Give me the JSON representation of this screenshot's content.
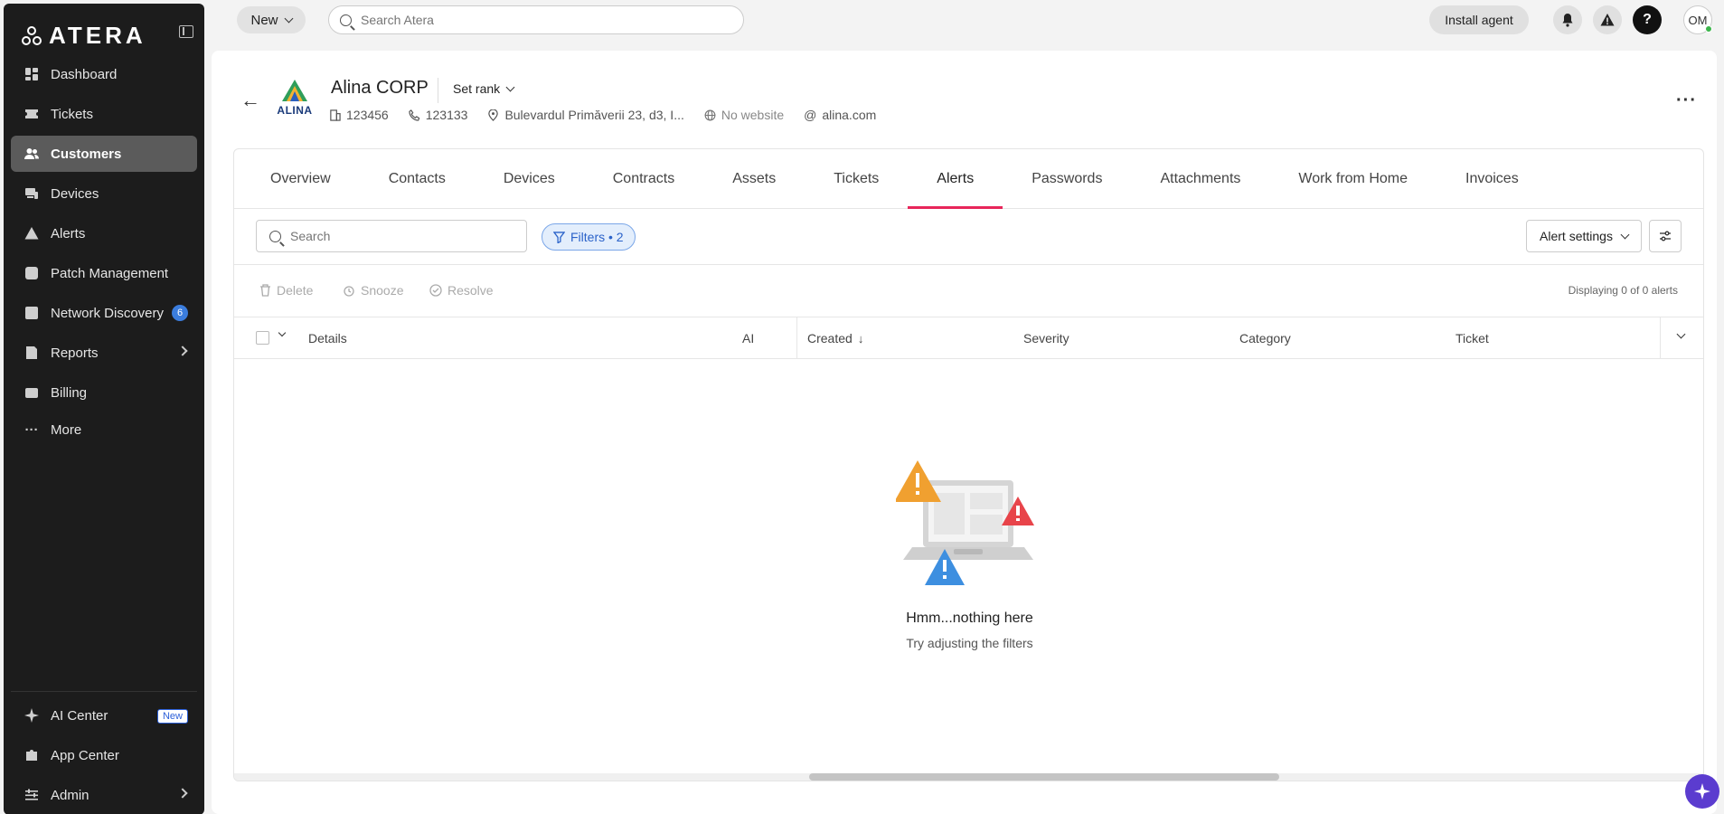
{
  "app": {
    "logo_text": "ATERA"
  },
  "sidebar": {
    "items": [
      {
        "label": "Dashboard"
      },
      {
        "label": "Tickets"
      },
      {
        "label": "Customers",
        "active": true
      },
      {
        "label": "Devices"
      },
      {
        "label": "Alerts"
      },
      {
        "label": "Patch Management"
      },
      {
        "label": "Network Discovery",
        "badge": "6"
      },
      {
        "label": "Reports"
      },
      {
        "label": "Billing"
      }
    ],
    "more_label": "More",
    "bottom": [
      {
        "label": "AI Center",
        "tag": "New"
      },
      {
        "label": "App Center"
      },
      {
        "label": "Admin"
      }
    ]
  },
  "topbar": {
    "new_label": "New",
    "search_placeholder": "Search Atera",
    "install_label": "Install agent",
    "avatar_initials": "OM"
  },
  "customer": {
    "logo_text": "ALINA",
    "name": "Alina CORP",
    "set_rank_label": "Set rank",
    "company_id": "123456",
    "phone": "123133",
    "address": "Bulevardul Primăverii 23, d3, I...",
    "website": "No website",
    "domain": "alina.com"
  },
  "tabs": [
    "Overview",
    "Contacts",
    "Devices",
    "Contracts",
    "Assets",
    "Tickets",
    "Alerts",
    "Passwords",
    "Attachments",
    "Work from Home",
    "Invoices"
  ],
  "active_tab": "Alerts",
  "filters": {
    "search_placeholder": "Search",
    "filters_label": "Filters • 2",
    "alert_settings_label": "Alert settings"
  },
  "actions": {
    "delete": "Delete",
    "snooze": "Snooze",
    "resolve": "Resolve",
    "displaying": "Displaying 0 of 0 alerts"
  },
  "table": {
    "columns": [
      "Details",
      "AI",
      "Created",
      "Severity",
      "Category",
      "Ticket"
    ]
  },
  "empty": {
    "title": "Hmm...nothing here",
    "subtitle": "Try adjusting the filters"
  },
  "colors": {
    "accent": "#e8255a",
    "sidebar_bg": "#1c1c1c",
    "chip_blue": "#2a62c9",
    "warn_orange": "#f0a030",
    "warn_red": "#e8444a",
    "warn_blue": "#3d8fe0"
  }
}
